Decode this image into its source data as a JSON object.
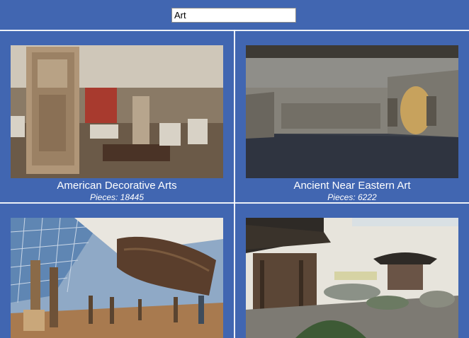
{
  "search": {
    "value": "Art"
  },
  "departments": [
    {
      "title": "American Decorative Arts",
      "pieces": "Pieces: 18445"
    },
    {
      "title": "Ancient Near Eastern Art",
      "pieces": "Pieces: 6222"
    },
    {
      "title": "",
      "pieces": ""
    },
    {
      "title": "",
      "pieces": ""
    }
  ]
}
